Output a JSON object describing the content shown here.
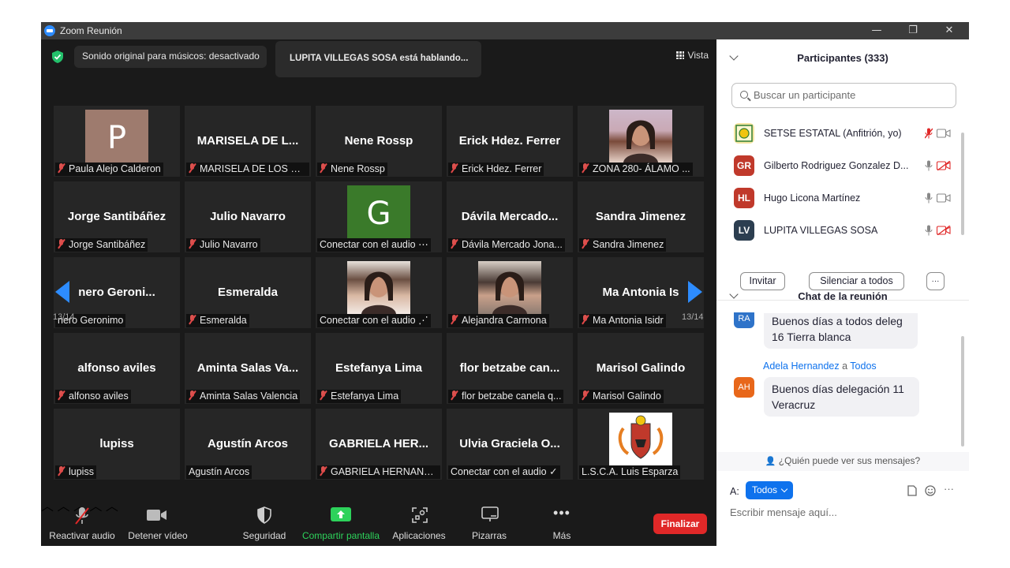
{
  "window": {
    "title": "Zoom Reunión",
    "controls": [
      "—",
      "❐",
      "✕"
    ]
  },
  "meeting": {
    "audio_badge": "Sonido original para músicos: desactivado",
    "speaking_banner": "LUPITA  VILLEGAS SOSA está hablando...",
    "view_label": "Vista",
    "page_left": "13/14",
    "page_right": "13/14",
    "tiles": [
      {
        "big": "",
        "label": "Paula Alejo Calderon",
        "muted": true,
        "thumb": "P",
        "thumb_color": "#9e7b6e"
      },
      {
        "big": "MARISELA DE L...",
        "label": "MARISELA DE LOS SA...",
        "muted": true
      },
      {
        "big": "Nene Rossp",
        "label": "Nene Rossp",
        "muted": true
      },
      {
        "big": "Erick Hdez. Ferrer",
        "label": "Erick Hdez. Ferrer",
        "muted": true
      },
      {
        "big": "",
        "label": "ZONA 280- ÁLAMO ...",
        "muted": true,
        "photo": "woman-selfie"
      },
      {
        "big": "Jorge Santibáñez",
        "label": "Jorge Santibáñez",
        "muted": true
      },
      {
        "big": "Julio Navarro",
        "label": "Julio Navarro",
        "muted": true
      },
      {
        "big": "",
        "label": "Conectar con el audio ⋯",
        "muted": false,
        "thumb": "G",
        "thumb_color": "#3a7a2a"
      },
      {
        "big": "Dávila  Mercado...",
        "label": "Dávila Mercado Jona...",
        "muted": true
      },
      {
        "big": "Sandra Jimenez",
        "label": "Sandra Jimenez",
        "muted": true
      },
      {
        "big": "nero  Geroni...",
        "label": "nero Geronimo",
        "muted": false
      },
      {
        "big": "Esmeralda",
        "label": "Esmeralda",
        "muted": true
      },
      {
        "big": "",
        "label": "Conectar con el audio ⋰",
        "muted": false,
        "photo": "woman-portrait"
      },
      {
        "big": "",
        "label": "Alejandra Carmona",
        "muted": true,
        "photo": "woman-car"
      },
      {
        "big": "Ma Antonia Is",
        "label": "Ma Antonia Isidr",
        "muted": true
      },
      {
        "big": "alfonso aviles",
        "label": "alfonso aviles",
        "muted": true
      },
      {
        "big": "Aminta Salas Va...",
        "label": "Aminta Salas Valencia",
        "muted": true
      },
      {
        "big": "Estefanya Lima",
        "label": "Estefanya Lima",
        "muted": true
      },
      {
        "big": "flor  betzabe  can...",
        "label": "flor betzabe canela q...",
        "muted": true
      },
      {
        "big": "Marisol Galindo",
        "label": "Marisol Galindo",
        "muted": true
      },
      {
        "big": "lupiss",
        "label": "lupiss",
        "muted": true
      },
      {
        "big": "Agustín Arcos",
        "label": "Agustín Arcos",
        "muted": false
      },
      {
        "big": "GABRIELA HER...",
        "label": "GABRIELA HERNAND...",
        "muted": true
      },
      {
        "big": "Ulvia Graciela O...",
        "label": "Conectar con el audio ✓",
        "muted": false
      },
      {
        "big": "",
        "label": "L.S.C.A. Luis Esparza",
        "muted": false,
        "photo": "coat-of-arms"
      }
    ]
  },
  "toolbar": {
    "unmute": "Reactivar audio",
    "stop_video": "Detener vídeo",
    "security": "Seguridad",
    "share": "Compartir pantalla",
    "apps": "Aplicaciones",
    "whiteboards": "Pizarras",
    "more": "Más",
    "end": "Finalizar",
    "share_color": "#2dd25b",
    "end_color": "#e02828"
  },
  "participants": {
    "title": "Participantes (333)",
    "search_placeholder": "Buscar un participante",
    "list": [
      {
        "initials": "",
        "name": "SETSE ESTATAL (Anfitrión, yo)",
        "color": "#f5e6a3",
        "mic": "muted-red",
        "cam": "on"
      },
      {
        "initials": "GR",
        "name": "Gilberto Rodriguez Gonzalez D...",
        "color": "#c0392b",
        "mic": "on",
        "cam": "off-red"
      },
      {
        "initials": "HL",
        "name": "Hugo Licona Martínez",
        "color": "#c0392b",
        "mic": "on",
        "cam": "on"
      },
      {
        "initials": "LV",
        "name": "LUPITA  VILLEGAS SOSA",
        "color": "#2c3e50",
        "mic": "active",
        "cam": "off-red"
      }
    ],
    "invite": "Invitar",
    "mute_all": "Silenciar a todos",
    "more": "···"
  },
  "chat": {
    "title": "Chat de la reunión",
    "messages": [
      {
        "initials": "RA",
        "color": "#2e73c9",
        "text_line1": "Buenos días a todos deleg",
        "text_line2": "16 Tierra blanca"
      },
      {
        "sender": "Adela Hernandez",
        "connector": "a",
        "recipient": "Todos",
        "initials": "AH",
        "color": "#e8671a",
        "text_line1": "Buenos días delegación 11",
        "text_line2": "Veracruz"
      }
    ],
    "who_can_see": "¿Quién puede ver sus mensajes?",
    "to_label": "A:",
    "to_value": "Todos",
    "input_placeholder": "Escribir mensaje aquí..."
  }
}
